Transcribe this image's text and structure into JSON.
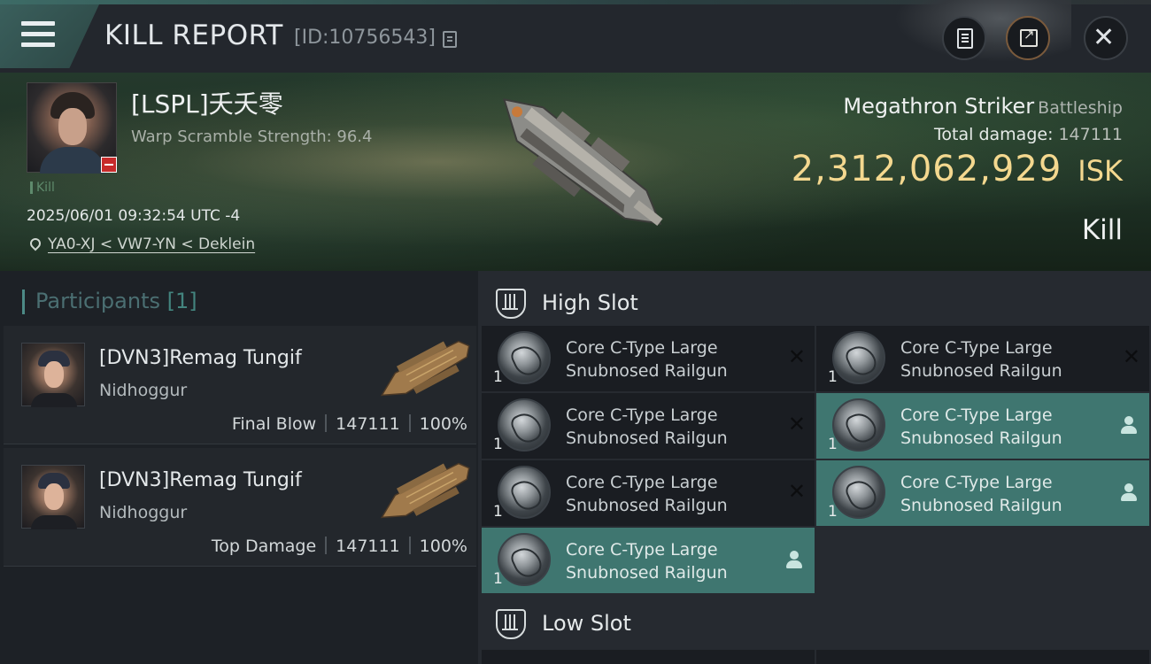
{
  "header": {
    "title": "KILL REPORT",
    "report_id": "[ID:10756543]"
  },
  "victim": {
    "name": "[LSPL]夭夭零",
    "warp_scramble": "Warp Scramble Strength: 96.4",
    "kill_tag": "Kill",
    "datetime": "2025/06/01 09:32:54 UTC -4",
    "location": "YA0-XJ < VW7-YN < Deklein"
  },
  "ship": {
    "name": "Megathron Striker",
    "class": "Battleship",
    "total_damage_label": "Total damage:",
    "total_damage_value": "147111",
    "isk_value": "2,312,062,929",
    "isk_unit": "ISK",
    "result": "Kill"
  },
  "participants": {
    "title": "Participants",
    "count": "[1]",
    "rows": [
      {
        "name": "[DVN3]Remag Tungif",
        "ship": "Nidhoggur",
        "role": "Final Blow",
        "damage": "147111",
        "percent": "100%"
      },
      {
        "name": "[DVN3]Remag Tungif",
        "ship": "Nidhoggur",
        "role": "Top Damage",
        "damage": "147111",
        "percent": "100%"
      }
    ]
  },
  "fitting": {
    "high_slot_title": "High Slot",
    "low_slot_title": "Low Slot",
    "high_modules": [
      {
        "qty": "1",
        "name_line1": "Core C-Type Large",
        "name_line2": "Snubnosed Railgun",
        "status": "destroyed"
      },
      {
        "qty": "1",
        "name_line1": "Core C-Type Large",
        "name_line2": "Snubnosed Railgun",
        "status": "destroyed"
      },
      {
        "qty": "1",
        "name_line1": "Core C-Type Large",
        "name_line2": "Snubnosed Railgun",
        "status": "destroyed"
      },
      {
        "qty": "1",
        "name_line1": "Core C-Type Large",
        "name_line2": "Snubnosed Railgun",
        "status": "dropped"
      },
      {
        "qty": "1",
        "name_line1": "Core C-Type Large",
        "name_line2": "Snubnosed Railgun",
        "status": "destroyed"
      },
      {
        "qty": "1",
        "name_line1": "Core C-Type Large",
        "name_line2": "Snubnosed Railgun",
        "status": "dropped"
      },
      {
        "qty": "1",
        "name_line1": "Core C-Type Large",
        "name_line2": "Snubnosed Railgun",
        "status": "dropped"
      }
    ]
  },
  "colors": {
    "isk_gold": "#f4d88f",
    "dropped_teal": "#3f7670",
    "accent_teal": "#4c8a86",
    "loss_red": "#c72b2b"
  }
}
